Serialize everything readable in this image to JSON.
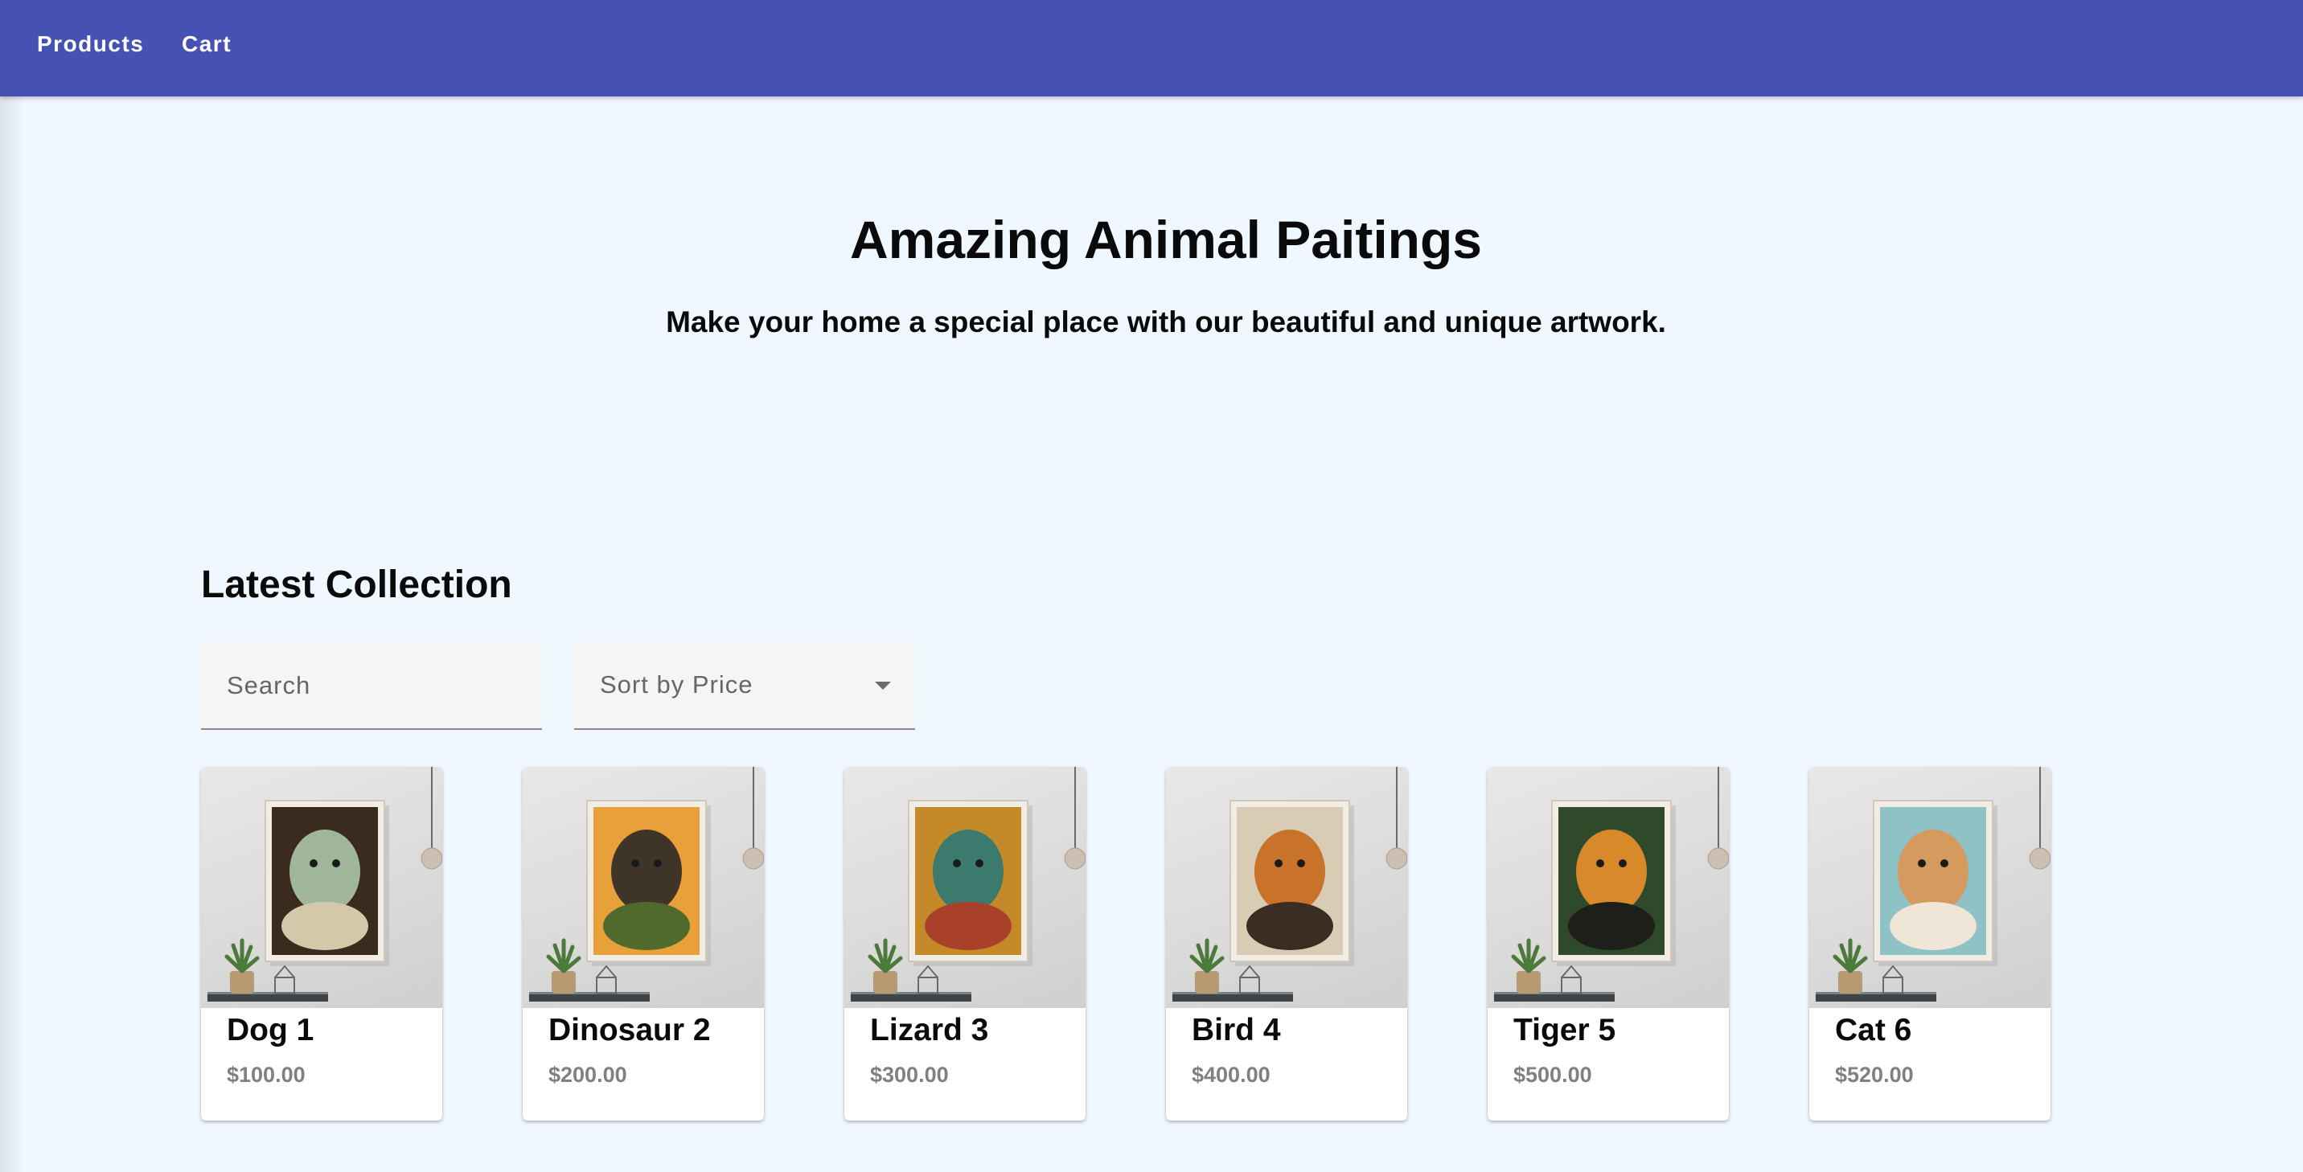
{
  "nav": {
    "products_label": "Products",
    "cart_label": "Cart"
  },
  "hero": {
    "title": "Amazing Animal Paitings",
    "subtitle": "Make your home a special place with our beautiful and unique artwork."
  },
  "collection": {
    "title": "Latest Collection",
    "search_placeholder": "Search",
    "sort_label": "Sort by Price"
  },
  "products": [
    {
      "name": "Dog 1",
      "price": "$100.00",
      "art": "dog-painting",
      "colors": [
        "#3b2a1e",
        "#a0b69a",
        "#d4c8a8"
      ]
    },
    {
      "name": "Dinosaur 2",
      "price": "$200.00",
      "art": "dinosaur-painting",
      "colors": [
        "#e8a13a",
        "#3f3428",
        "#4f6a2c"
      ]
    },
    {
      "name": "Lizard 3",
      "price": "$300.00",
      "art": "lizard-painting",
      "colors": [
        "#c48a2a",
        "#3c7a6e",
        "#a8402a"
      ]
    },
    {
      "name": "Bird 4",
      "price": "$400.00",
      "art": "bird-painting",
      "colors": [
        "#d8cdb4",
        "#c8722a",
        "#3a2e22"
      ]
    },
    {
      "name": "Tiger 5",
      "price": "$500.00",
      "art": "tiger-painting",
      "colors": [
        "#2f4a2a",
        "#d88a2a",
        "#1e1e1a"
      ]
    },
    {
      "name": "Cat 6",
      "price": "$520.00",
      "art": "cat-painting",
      "colors": [
        "#8fc2c4",
        "#d49a5e",
        "#f0e6d8"
      ]
    }
  ]
}
